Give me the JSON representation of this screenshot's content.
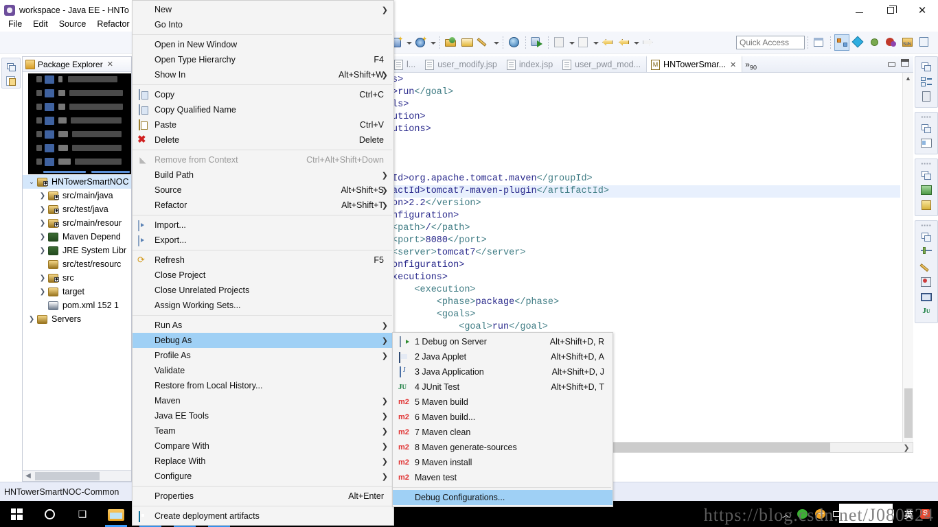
{
  "window": {
    "title": "workspace - Java EE - HNTo",
    "minimize": "—",
    "maximize": "❐",
    "close": "✕"
  },
  "menubar": [
    "File",
    "Edit",
    "Source",
    "Refactor"
  ],
  "toolbar": {
    "quick_access_placeholder": "Quick Access",
    "icons": [
      "new-wizard-icon",
      "new-dropdown-caret",
      "save-icon",
      "save-dropdown-caret",
      "open-package-icon",
      "open-folder-icon",
      "pencil-icon",
      "pencil-dropdown-caret",
      "globe-icon",
      "run-icon",
      "external-tools-icon",
      "external-tools-caret",
      "new-java-package-icon",
      "new-java-package-caret",
      "back-star-icon",
      "back-icon",
      "back-caret",
      "forward-icon"
    ],
    "perspective_icons": [
      "open-perspective-icon",
      "java-ee-perspective-icon",
      "diamond-perspective-icon",
      "debug-perspective-icon",
      "team-sync-perspective-icon",
      "sun-perspective-icon",
      "resource-perspective-icon"
    ]
  },
  "explorer": {
    "tab_label": "Package Explorer",
    "tree": [
      {
        "label": "",
        "redacted": true
      },
      {
        "label": "HNTowerSmartNOC",
        "indent": 0,
        "selected": true,
        "arrow": "v",
        "icon": "java-project-icon"
      },
      {
        "label": "src/main/java",
        "indent": 1,
        "arrow": ">",
        "icon": "source-folder-icon"
      },
      {
        "label": "src/test/java",
        "indent": 1,
        "arrow": ">",
        "icon": "source-folder-icon"
      },
      {
        "label": "src/main/resour",
        "indent": 1,
        "arrow": ">",
        "icon": "source-folder-icon"
      },
      {
        "label": "Maven Depend",
        "indent": 1,
        "arrow": ">",
        "icon": "library-icon"
      },
      {
        "label": "JRE System Libr",
        "indent": 1,
        "arrow": ">",
        "icon": "library-icon"
      },
      {
        "label": "src/test/resourc",
        "indent": 1,
        "arrow": "",
        "icon": "folder-icon"
      },
      {
        "label": "src",
        "indent": 1,
        "arrow": ">",
        "icon": "source-folder-icon"
      },
      {
        "label": "target",
        "indent": 1,
        "arrow": ">",
        "icon": "folder-icon"
      },
      {
        "label": "pom.xml  152  1",
        "indent": 1,
        "arrow": "",
        "icon": "xml-file-icon"
      },
      {
        "label": "Servers",
        "indent": 0,
        "arrow": ">",
        "icon": "folder-icon"
      }
    ]
  },
  "editor": {
    "tabs": [
      {
        "label": "l...",
        "active": false,
        "icon": "jsp-file-icon"
      },
      {
        "label": "user_modify.jsp",
        "active": false,
        "icon": "jsp-file-icon"
      },
      {
        "label": "index.jsp",
        "active": false,
        "icon": "jsp-file-icon"
      },
      {
        "label": "user_pwd_mod...",
        "active": false,
        "icon": "jsp-file-icon"
      },
      {
        "label": "HNTowerSmar...",
        "active": true,
        "icon": "maven-pom-icon"
      }
    ],
    "overflow_label": "»",
    "overflow_count": "90",
    "code_lines": [
      {
        "text": "s>",
        "hl": false
      },
      {
        "text": ">run</goal>",
        "hl": false
      },
      {
        "text": "ls>",
        "hl": false
      },
      {
        "text": "ution>",
        "hl": false
      },
      {
        "text": "utions>",
        "hl": false
      },
      {
        "text": "",
        "hl": false
      },
      {
        "text": "",
        "hl": false
      },
      {
        "text": "",
        "hl": false
      },
      {
        "text": "Id>org.apache.tomcat.maven</groupId>",
        "hl": false
      },
      {
        "text": "actId>tomcat7-maven-plugin</artifactId>",
        "hl": true
      },
      {
        "text": "on>2.2</version>",
        "hl": false
      },
      {
        "text": "nfiguration>",
        "hl": false
      },
      {
        "text": "<path>/</path>",
        "hl": false
      },
      {
        "text": "<port>8080</port>",
        "hl": false
      },
      {
        "text": "<server>tomcat7</server>",
        "hl": false
      },
      {
        "text": "onfiguration>",
        "hl": false
      },
      {
        "text": "xecutions>",
        "hl": false
      },
      {
        "text": "    <execution>",
        "hl": false
      },
      {
        "text": "        <phase>package</phase>",
        "hl": false
      },
      {
        "text": "        <goals>",
        "hl": false
      },
      {
        "text": "            <goal>run</goal>",
        "hl": false
      }
    ]
  },
  "context_menu": {
    "items": [
      {
        "label": "New",
        "accel": "",
        "submenu": true,
        "icon": ""
      },
      {
        "label": "Go Into",
        "accel": "",
        "submenu": false,
        "icon": ""
      },
      {
        "separator": true
      },
      {
        "label": "Open in New Window",
        "accel": "",
        "submenu": false,
        "icon": ""
      },
      {
        "label": "Open Type Hierarchy",
        "accel": "F4",
        "submenu": false,
        "icon": ""
      },
      {
        "label": "Show In",
        "accel": "Alt+Shift+W",
        "submenu": true,
        "icon": ""
      },
      {
        "separator": true
      },
      {
        "label": "Copy",
        "accel": "Ctrl+C",
        "submenu": false,
        "icon": "copy-icon"
      },
      {
        "label": "Copy Qualified Name",
        "accel": "",
        "submenu": false,
        "icon": "copy-qualified-icon"
      },
      {
        "label": "Paste",
        "accel": "Ctrl+V",
        "submenu": false,
        "icon": "paste-icon"
      },
      {
        "label": "Delete",
        "accel": "Delete",
        "submenu": false,
        "icon": "delete-icon"
      },
      {
        "separator": true
      },
      {
        "label": "Remove from Context",
        "accel": "Ctrl+Alt+Shift+Down",
        "submenu": false,
        "disabled": true,
        "icon": "remove-context-icon"
      },
      {
        "label": "Build Path",
        "accel": "",
        "submenu": true,
        "icon": ""
      },
      {
        "label": "Source",
        "accel": "Alt+Shift+S",
        "submenu": true,
        "icon": ""
      },
      {
        "label": "Refactor",
        "accel": "Alt+Shift+T",
        "submenu": true,
        "icon": ""
      },
      {
        "separator": true
      },
      {
        "label": "Import...",
        "accel": "",
        "submenu": false,
        "icon": "import-icon"
      },
      {
        "label": "Export...",
        "accel": "",
        "submenu": false,
        "icon": "export-icon"
      },
      {
        "separator": true
      },
      {
        "label": "Refresh",
        "accel": "F5",
        "submenu": false,
        "icon": "refresh-icon"
      },
      {
        "label": "Close Project",
        "accel": "",
        "submenu": false,
        "icon": ""
      },
      {
        "label": "Close Unrelated Projects",
        "accel": "",
        "submenu": false,
        "icon": ""
      },
      {
        "label": "Assign Working Sets...",
        "accel": "",
        "submenu": false,
        "icon": ""
      },
      {
        "separator": true
      },
      {
        "label": "Run As",
        "accel": "",
        "submenu": true,
        "icon": ""
      },
      {
        "label": "Debug As",
        "accel": "",
        "submenu": true,
        "icon": "",
        "highlighted": true
      },
      {
        "label": "Profile As",
        "accel": "",
        "submenu": true,
        "icon": ""
      },
      {
        "label": "Validate",
        "accel": "",
        "submenu": false,
        "icon": ""
      },
      {
        "label": "Restore from Local History...",
        "accel": "",
        "submenu": false,
        "icon": ""
      },
      {
        "label": "Maven",
        "accel": "",
        "submenu": true,
        "icon": ""
      },
      {
        "label": "Java EE Tools",
        "accel": "",
        "submenu": true,
        "icon": ""
      },
      {
        "label": "Team",
        "accel": "",
        "submenu": true,
        "icon": ""
      },
      {
        "label": "Compare With",
        "accel": "",
        "submenu": true,
        "icon": ""
      },
      {
        "label": "Replace With",
        "accel": "",
        "submenu": true,
        "icon": ""
      },
      {
        "label": "Configure",
        "accel": "",
        "submenu": true,
        "icon": ""
      },
      {
        "separator": true
      },
      {
        "label": "Properties",
        "accel": "Alt+Enter",
        "submenu": false,
        "icon": ""
      },
      {
        "separator": true
      },
      {
        "label": "Create deployment artifacts",
        "accel": "",
        "submenu": false,
        "icon": "deploy-icon"
      }
    ]
  },
  "debug_as_submenu": {
    "items": [
      {
        "label": "1 Debug on Server",
        "accel": "Alt+Shift+D, R",
        "icon": "server-icon"
      },
      {
        "label": "2 Java Applet",
        "accel": "Alt+Shift+D, A",
        "icon": "applet-icon"
      },
      {
        "label": "3 Java Application",
        "accel": "Alt+Shift+D, J",
        "icon": "java-app-icon"
      },
      {
        "label": "4 JUnit Test",
        "accel": "Alt+Shift+D, T",
        "icon": "junit-icon"
      },
      {
        "label": "5 Maven build",
        "accel": "",
        "icon": "maven-icon"
      },
      {
        "label": "6 Maven build...",
        "accel": "",
        "icon": "maven-icon"
      },
      {
        "label": "7 Maven clean",
        "accel": "",
        "icon": "maven-icon"
      },
      {
        "label": "8 Maven generate-sources",
        "accel": "",
        "icon": "maven-icon"
      },
      {
        "label": "9 Maven install",
        "accel": "",
        "icon": "maven-icon"
      },
      {
        "label": "Maven test",
        "accel": "",
        "icon": "maven-icon"
      },
      {
        "separator": true
      },
      {
        "label": "Debug Configurations...",
        "accel": "",
        "icon": "",
        "highlighted": true
      }
    ]
  },
  "statusbar": {
    "text": "HNTowerSmartNOC-Common"
  },
  "taskbar": {
    "start": "windows-logo",
    "items": [
      "cortana-circle",
      "task-view",
      "file-explorer",
      "eclipse-1",
      "jee-ide",
      "eclipse-2",
      "other-app"
    ],
    "tray": [
      "chevron-up",
      "wechat",
      "security",
      "battery",
      "penguin",
      "display",
      "volume",
      "ime-english",
      "sogou"
    ]
  },
  "watermark": {
    "text": "https://blog.csdn.net/J080524"
  },
  "colors": {
    "menu_highlight": "#9fd0f5",
    "tree_selection": "#d4e7fb",
    "code_tag": "#3f7c84",
    "code_text": "#2a2a8c",
    "toolbar_bg": "#f4f6fb",
    "status_bg": "#e8ecf8"
  }
}
